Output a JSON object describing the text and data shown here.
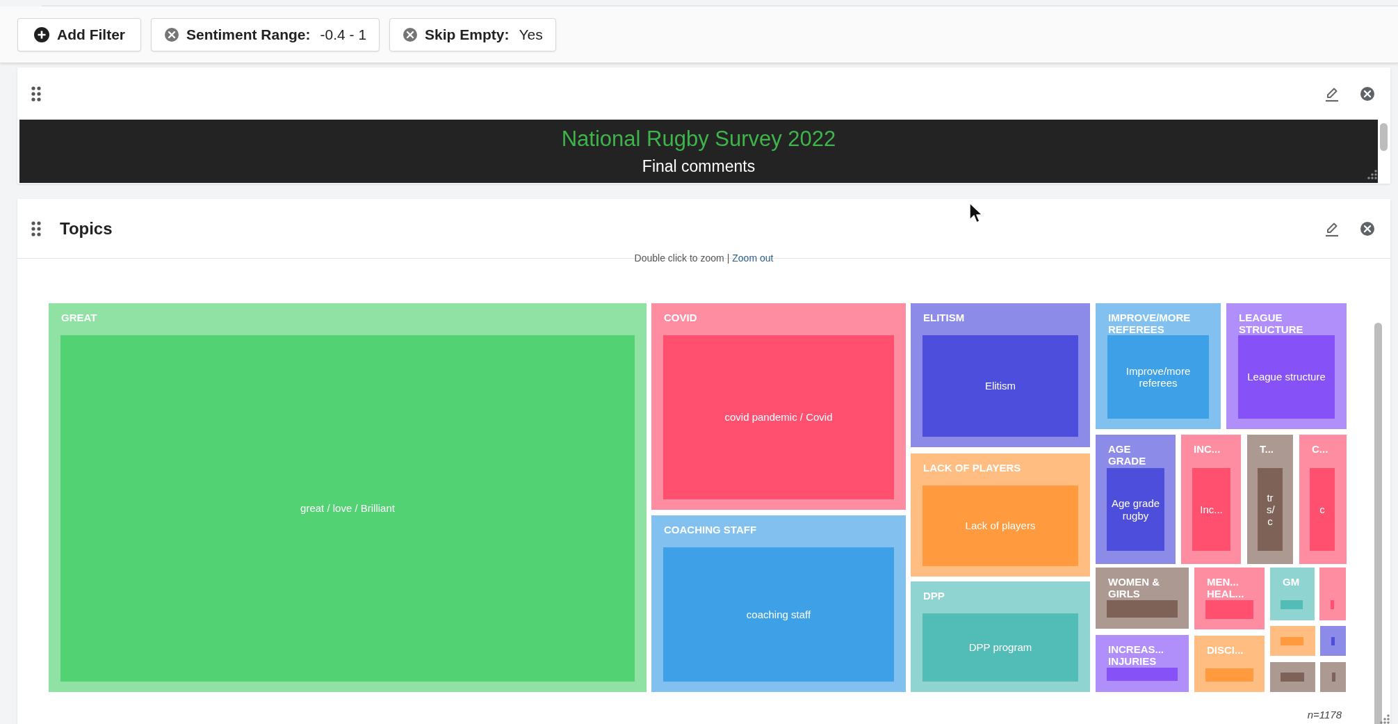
{
  "filter_bar": {
    "add_button": "Add Filter",
    "filters": [
      {
        "name": "Sentiment Range:",
        "value": "-0.4 - 1"
      },
      {
        "name": "Skip Empty:",
        "value": "Yes"
      }
    ]
  },
  "header_widget": {
    "title": "National Rugby Survey 2022",
    "subtitle": "Final comments"
  },
  "topics_widget": {
    "title": "Topics",
    "hint": "Double click to zoom |",
    "zoom_link": "Zoom out",
    "sample_size": "n=1178",
    "tiles": [
      {
        "label": "GREAT",
        "inner": "great / love / Brilliant",
        "color": "#52d273"
      },
      {
        "label": "COVID",
        "inner": "covid pandemic / Covid",
        "color": "#ff5070"
      },
      {
        "label": "COACHING STAFF",
        "inner": "coaching staff",
        "color": "#3ea0e6"
      },
      {
        "label": "ELITISM",
        "inner": "Elitism",
        "color": "#4e4edc"
      },
      {
        "label": "LACK OF PLAYERS",
        "inner": "Lack of players",
        "color": "#ff9a3e"
      },
      {
        "label": "DPP",
        "inner": "DPP program",
        "color": "#52bdb6"
      },
      {
        "label": "IMPROVE/MORE REFEREES",
        "inner": "Improve/more referees",
        "color": "#3ea0e6"
      },
      {
        "label": "LEAGUE STRUCTURE",
        "inner": "League structure",
        "color": "#8652f8"
      },
      {
        "label": "AGE GRADE",
        "inner": "Age grade rugby",
        "color": "#4e4edc"
      },
      {
        "label": "INC...",
        "inner": "Inc...",
        "color": "#ff5070"
      },
      {
        "label": "T...",
        "inner": "trs/c",
        "color": "#7f6257"
      },
      {
        "label": "C...",
        "inner": "c",
        "color": "#ff5070"
      },
      {
        "label": "WOMEN & GIRLS",
        "color": "#7f6257"
      },
      {
        "label": "MEN... HEAL...",
        "color": "#ff5070"
      },
      {
        "label": "GM",
        "color": "#52bdb6"
      },
      {
        "color": "#ff5070"
      },
      {
        "label": "INCREAS... INJURIES",
        "color": "#8652f8"
      },
      {
        "label": "DISCI...",
        "color": "#ff9a3e"
      },
      {
        "color": "#ff9a3e"
      },
      {
        "color": "#4e4edc"
      },
      {
        "color": "#7f6257"
      },
      {
        "color": "#7f6257"
      }
    ]
  }
}
